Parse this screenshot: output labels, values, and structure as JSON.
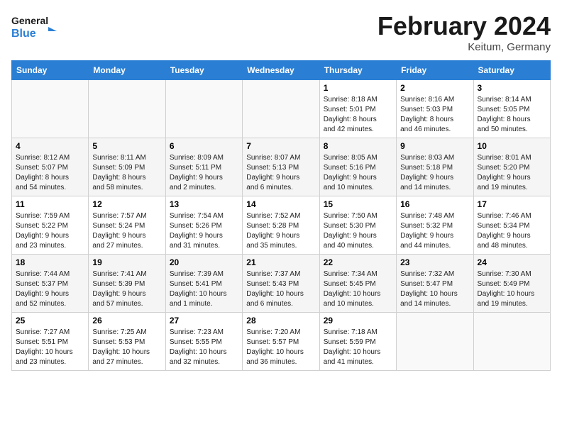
{
  "header": {
    "logo_line1": "General",
    "logo_line2": "Blue",
    "month_title": "February 2024",
    "location": "Keitum, Germany"
  },
  "weekdays": [
    "Sunday",
    "Monday",
    "Tuesday",
    "Wednesday",
    "Thursday",
    "Friday",
    "Saturday"
  ],
  "weeks": [
    [
      {
        "day": "",
        "info": ""
      },
      {
        "day": "",
        "info": ""
      },
      {
        "day": "",
        "info": ""
      },
      {
        "day": "",
        "info": ""
      },
      {
        "day": "1",
        "info": "Sunrise: 8:18 AM\nSunset: 5:01 PM\nDaylight: 8 hours\nand 42 minutes."
      },
      {
        "day": "2",
        "info": "Sunrise: 8:16 AM\nSunset: 5:03 PM\nDaylight: 8 hours\nand 46 minutes."
      },
      {
        "day": "3",
        "info": "Sunrise: 8:14 AM\nSunset: 5:05 PM\nDaylight: 8 hours\nand 50 minutes."
      }
    ],
    [
      {
        "day": "4",
        "info": "Sunrise: 8:12 AM\nSunset: 5:07 PM\nDaylight: 8 hours\nand 54 minutes."
      },
      {
        "day": "5",
        "info": "Sunrise: 8:11 AM\nSunset: 5:09 PM\nDaylight: 8 hours\nand 58 minutes."
      },
      {
        "day": "6",
        "info": "Sunrise: 8:09 AM\nSunset: 5:11 PM\nDaylight: 9 hours\nand 2 minutes."
      },
      {
        "day": "7",
        "info": "Sunrise: 8:07 AM\nSunset: 5:13 PM\nDaylight: 9 hours\nand 6 minutes."
      },
      {
        "day": "8",
        "info": "Sunrise: 8:05 AM\nSunset: 5:16 PM\nDaylight: 9 hours\nand 10 minutes."
      },
      {
        "day": "9",
        "info": "Sunrise: 8:03 AM\nSunset: 5:18 PM\nDaylight: 9 hours\nand 14 minutes."
      },
      {
        "day": "10",
        "info": "Sunrise: 8:01 AM\nSunset: 5:20 PM\nDaylight: 9 hours\nand 19 minutes."
      }
    ],
    [
      {
        "day": "11",
        "info": "Sunrise: 7:59 AM\nSunset: 5:22 PM\nDaylight: 9 hours\nand 23 minutes."
      },
      {
        "day": "12",
        "info": "Sunrise: 7:57 AM\nSunset: 5:24 PM\nDaylight: 9 hours\nand 27 minutes."
      },
      {
        "day": "13",
        "info": "Sunrise: 7:54 AM\nSunset: 5:26 PM\nDaylight: 9 hours\nand 31 minutes."
      },
      {
        "day": "14",
        "info": "Sunrise: 7:52 AM\nSunset: 5:28 PM\nDaylight: 9 hours\nand 35 minutes."
      },
      {
        "day": "15",
        "info": "Sunrise: 7:50 AM\nSunset: 5:30 PM\nDaylight: 9 hours\nand 40 minutes."
      },
      {
        "day": "16",
        "info": "Sunrise: 7:48 AM\nSunset: 5:32 PM\nDaylight: 9 hours\nand 44 minutes."
      },
      {
        "day": "17",
        "info": "Sunrise: 7:46 AM\nSunset: 5:34 PM\nDaylight: 9 hours\nand 48 minutes."
      }
    ],
    [
      {
        "day": "18",
        "info": "Sunrise: 7:44 AM\nSunset: 5:37 PM\nDaylight: 9 hours\nand 52 minutes."
      },
      {
        "day": "19",
        "info": "Sunrise: 7:41 AM\nSunset: 5:39 PM\nDaylight: 9 hours\nand 57 minutes."
      },
      {
        "day": "20",
        "info": "Sunrise: 7:39 AM\nSunset: 5:41 PM\nDaylight: 10 hours\nand 1 minute."
      },
      {
        "day": "21",
        "info": "Sunrise: 7:37 AM\nSunset: 5:43 PM\nDaylight: 10 hours\nand 6 minutes."
      },
      {
        "day": "22",
        "info": "Sunrise: 7:34 AM\nSunset: 5:45 PM\nDaylight: 10 hours\nand 10 minutes."
      },
      {
        "day": "23",
        "info": "Sunrise: 7:32 AM\nSunset: 5:47 PM\nDaylight: 10 hours\nand 14 minutes."
      },
      {
        "day": "24",
        "info": "Sunrise: 7:30 AM\nSunset: 5:49 PM\nDaylight: 10 hours\nand 19 minutes."
      }
    ],
    [
      {
        "day": "25",
        "info": "Sunrise: 7:27 AM\nSunset: 5:51 PM\nDaylight: 10 hours\nand 23 minutes."
      },
      {
        "day": "26",
        "info": "Sunrise: 7:25 AM\nSunset: 5:53 PM\nDaylight: 10 hours\nand 27 minutes."
      },
      {
        "day": "27",
        "info": "Sunrise: 7:23 AM\nSunset: 5:55 PM\nDaylight: 10 hours\nand 32 minutes."
      },
      {
        "day": "28",
        "info": "Sunrise: 7:20 AM\nSunset: 5:57 PM\nDaylight: 10 hours\nand 36 minutes."
      },
      {
        "day": "29",
        "info": "Sunrise: 7:18 AM\nSunset: 5:59 PM\nDaylight: 10 hours\nand 41 minutes."
      },
      {
        "day": "",
        "info": ""
      },
      {
        "day": "",
        "info": ""
      }
    ]
  ]
}
